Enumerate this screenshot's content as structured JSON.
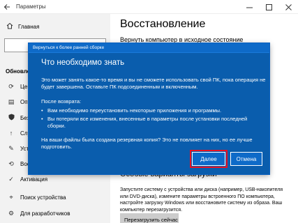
{
  "window": {
    "title": "Параметры",
    "back_icon": "back-arrow-icon"
  },
  "sidebar": {
    "home_label": "Главная",
    "section_label": "Обновлен",
    "items": [
      {
        "label": "Центр",
        "icon": "sync-icon"
      },
      {
        "label": "Опти",
        "icon": "delivery-optimization-icon"
      },
      {
        "label": "Безоп",
        "icon": "shield-icon"
      },
      {
        "label": "Служб",
        "icon": "backup-icon"
      },
      {
        "label": "Устра",
        "icon": "wrench-icon"
      },
      {
        "label": "Восст",
        "icon": "recovery-icon"
      },
      {
        "label": "Активация",
        "icon": "activation-icon"
      },
      {
        "label": "Поиск устройства",
        "icon": "find-device-icon"
      },
      {
        "label": "Для разработчиков",
        "icon": "developer-icon"
      }
    ]
  },
  "main": {
    "title": "Восстановление",
    "subtitle": "Вернуть компьютер в исходное состояние",
    "advanced": {
      "title": "Особые варианты загрузки",
      "text": "Запустите систему с устройства или диска (например, USB-накопителя или DVD-диска), измените параметры встроенного ПО компьютера, настройте загрузку Windows или восстановите систему из образа. Ваш компьютер перезагрузится.",
      "restart_label": "Перезагрузить сейчас"
    }
  },
  "dialog": {
    "caption": "Вернуться к более ранней сборке",
    "heading": "Что необходимо знать",
    "paragraph1": "Это может занять какое-то время и вы не сможете использовать свой ПК, пока операция не будет завершена. Оставьте ПК подсоединенным и включенным.",
    "after_return": "После возврата:",
    "bullet1": "Вам необходимо переустановить некоторые приложения и программы.",
    "bullet2": "Вы потеряли все изменения, внесенные в параметры после установки последней сборки.",
    "paragraph3": "На ваши файлы была создана резервная копия? Это не повлияет на них, но ее лучше подготовить.",
    "next_label": "Далее",
    "cancel_label": "Отмена",
    "bullet_char": "•"
  },
  "colors": {
    "dialog_bg": "#0a5dad",
    "button_bg": "#0e6ac8",
    "highlight": "#e81123",
    "sidebar_bg": "#f2f2f2"
  }
}
